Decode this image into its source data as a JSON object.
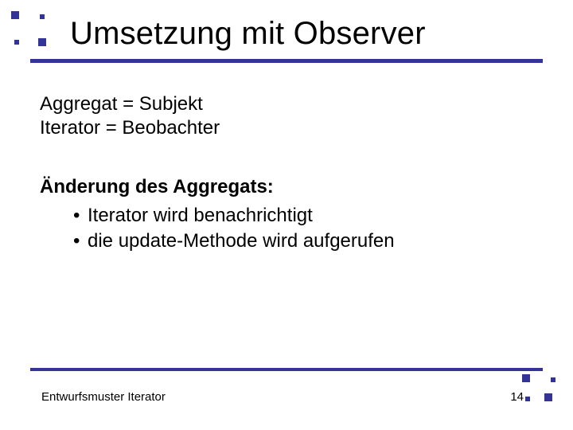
{
  "title": "Umsetzung mit Observer",
  "line1": "Aggregat = Subjekt",
  "line2": "Iterator = Beobachter",
  "change_heading": "Änderung des Aggregats:",
  "bullets": [
    "Iterator wird benachrichtigt",
    "die update-Methode wird aufgerufen"
  ],
  "footer_left": "Entwurfsmuster Iterator",
  "footer_page": "14"
}
